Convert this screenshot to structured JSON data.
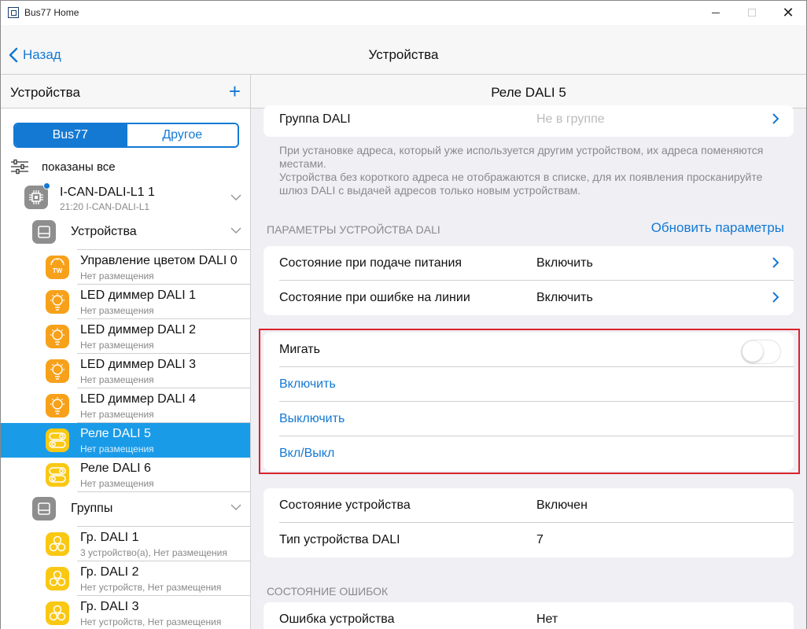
{
  "window": {
    "title": "Bus77 Home"
  },
  "navbar": {
    "back_label": "Назад",
    "title": "Устройства"
  },
  "sidebar": {
    "title": "Устройства",
    "add_symbol": "+",
    "segments": {
      "active": "Bus77",
      "inactive": "Другое"
    },
    "filter_label": "показаны все",
    "gateway": {
      "name": "I-CAN-DALI-L1 1",
      "sub": "21:20 I-CAN-DALI-L1"
    },
    "devices_folder": "Устройства",
    "devices": [
      {
        "name": "Управление цветом DALI 0",
        "sub": "Нет размещения",
        "icon": "color-temperature-icon",
        "badge": "TW"
      },
      {
        "name": "LED диммер DALI 1",
        "sub": "Нет размещения",
        "icon": "bulb-icon"
      },
      {
        "name": "LED диммер DALI 2",
        "sub": "Нет размещения",
        "icon": "bulb-icon"
      },
      {
        "name": "LED диммер DALI 3",
        "sub": "Нет размещения",
        "icon": "bulb-icon"
      },
      {
        "name": "LED диммер DALI 4",
        "sub": "Нет размещения",
        "icon": "bulb-icon"
      },
      {
        "name": "Реле DALI 5",
        "sub": "Нет размещения",
        "icon": "relay-icon",
        "selected": true
      },
      {
        "name": "Реле DALI 6",
        "sub": "Нет размещения",
        "icon": "relay-icon"
      }
    ],
    "groups_folder": "Группы",
    "groups": [
      {
        "name": "Гр. DALI 1",
        "sub": "3 устройство(а), Нет размещения"
      },
      {
        "name": "Гр. DALI 2",
        "sub": "Нет устройств, Нет размещения"
      },
      {
        "name": "Гр. DALI 3",
        "sub": "Нет устройств, Нет размещения"
      }
    ]
  },
  "detail": {
    "title": "Реле DALI 5",
    "group": {
      "label": "Группа DALI",
      "value": "Не в группе"
    },
    "note_line1": "При установке адреса, который уже используется другим устройством, их адреса поменяются местами.",
    "note_line2": "Устройства без короткого адреса не отображаются в списке, для их появления просканируйте шлюз DALI с выдачей адресов только новым устройствам.",
    "params_header": "ПАРАМЕТРЫ УСТРОЙСТВА DALI",
    "params_refresh": "Обновить параметры",
    "power_on": {
      "label": "Состояние при подаче питания",
      "value": "Включить"
    },
    "line_error": {
      "label": "Состояние при ошибке на линии",
      "value": "Включить"
    },
    "blink": {
      "label": "Мигать",
      "on": false
    },
    "actions": {
      "on": "Включить",
      "off": "Выключить",
      "toggle": "Вкл/Выкл"
    },
    "state": {
      "label": "Состояние устройства",
      "value": "Включен"
    },
    "type": {
      "label": "Тип устройства DALI",
      "value": "7"
    },
    "errors_header": "СОСТОЯНИЕ ОШИБОК",
    "device_error": {
      "label": "Ошибка устройства",
      "value": "Нет"
    }
  },
  "colors": {
    "accent": "#1479d3",
    "selected": "#1a9be8",
    "orange": "#f7a11a",
    "yellow": "#f9c813",
    "highlight": "#d9232d"
  }
}
